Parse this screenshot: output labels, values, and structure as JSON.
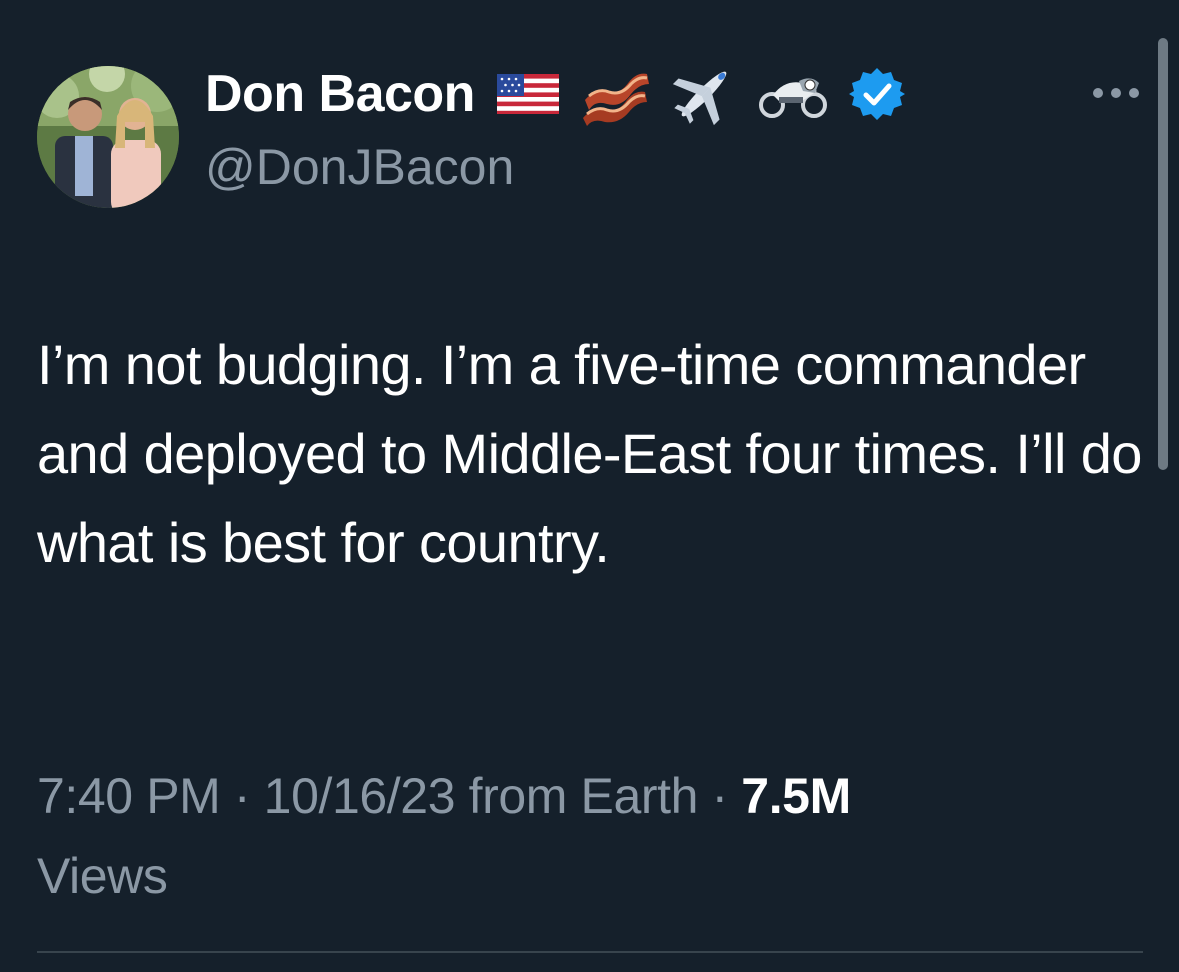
{
  "tweet": {
    "author": {
      "display_name": "Don Bacon",
      "handle": "@DonJBacon",
      "verified": true,
      "name_emojis": [
        "us-flag-icon",
        "bacon-icon",
        "airplane-icon",
        "motorcycle-icon"
      ]
    },
    "text": "I’m not budging. I’m a five-time commander and deployed to Middle-East four times. I’ll do what is best for country.",
    "time": "7:40 PM",
    "separator": "·",
    "date": "10/16/23",
    "source": "from Earth",
    "views_count": "7.5M",
    "views_label": "Views"
  },
  "colors": {
    "background": "#15202b",
    "primary_text": "#ffffff",
    "secondary_text": "#8b98a5",
    "verified_badge": "#1d9bf0",
    "divider": "#38444d"
  }
}
